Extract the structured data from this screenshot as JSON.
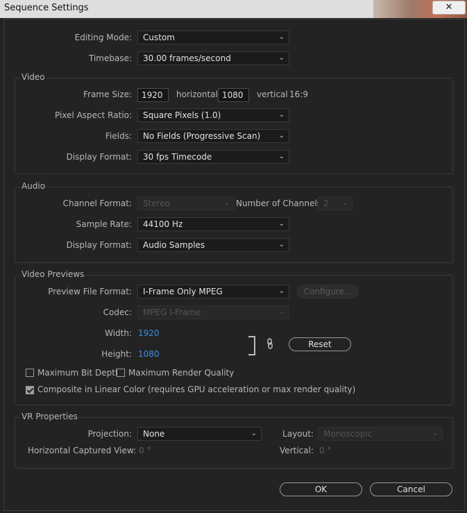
{
  "window": {
    "title": "Sequence Settings",
    "close_glyph": "✕"
  },
  "general": {
    "editing_mode": {
      "label": "Editing Mode:",
      "value": "Custom"
    },
    "timebase": {
      "label": "Timebase:",
      "value": "30.00  frames/second"
    }
  },
  "video": {
    "title": "Video",
    "frame_size": {
      "label": "Frame Size:",
      "width": "1920",
      "horizontal": "horizontal",
      "height": "1080",
      "vertical": "vertical",
      "ratio": "16:9"
    },
    "pixel_aspect_ratio": {
      "label": "Pixel Aspect Ratio:",
      "value": "Square Pixels (1.0)"
    },
    "fields": {
      "label": "Fields:",
      "value": "No Fields (Progressive Scan)"
    },
    "display_format": {
      "label": "Display Format:",
      "value": "30 fps Timecode"
    }
  },
  "audio": {
    "title": "Audio",
    "channel_format": {
      "label": "Channel Format:",
      "value": "Stereo"
    },
    "num_channels": {
      "label": "Number of Channels:",
      "value": "2"
    },
    "sample_rate": {
      "label": "Sample Rate:",
      "value": "44100 Hz"
    },
    "display_format": {
      "label": "Display Format:",
      "value": "Audio Samples"
    }
  },
  "previews": {
    "title": "Video Previews",
    "preview_file_format": {
      "label": "Preview File Format:",
      "value": "I-Frame Only MPEG"
    },
    "configure_label": "Configure...",
    "codec": {
      "label": "Codec:",
      "value": "MPEG I-Frame"
    },
    "width": {
      "label": "Width:",
      "value": "1920"
    },
    "height": {
      "label": "Height:",
      "value": "1080"
    },
    "reset_label": "Reset",
    "max_bit_depth": {
      "label": "Maximum Bit Depth",
      "checked": false
    },
    "max_render_quality": {
      "label": "Maximum Render Quality",
      "checked": false
    },
    "composite_linear": {
      "label": "Composite in Linear Color (requires GPU acceleration or max render quality)",
      "checked": true
    }
  },
  "vr": {
    "title": "VR Properties",
    "projection": {
      "label": "Projection:",
      "value": "None"
    },
    "layout": {
      "label": "Layout:",
      "value": "Monoscopic"
    },
    "h_captured_view": {
      "label": "Horizontal Captured View:",
      "value": "0 °"
    },
    "vertical": {
      "label": "Vertical:",
      "value": "0 °"
    }
  },
  "footer": {
    "ok_label": "OK",
    "cancel_label": "Cancel"
  },
  "icons": {
    "chevron": "⌄",
    "link": "link-icon"
  }
}
